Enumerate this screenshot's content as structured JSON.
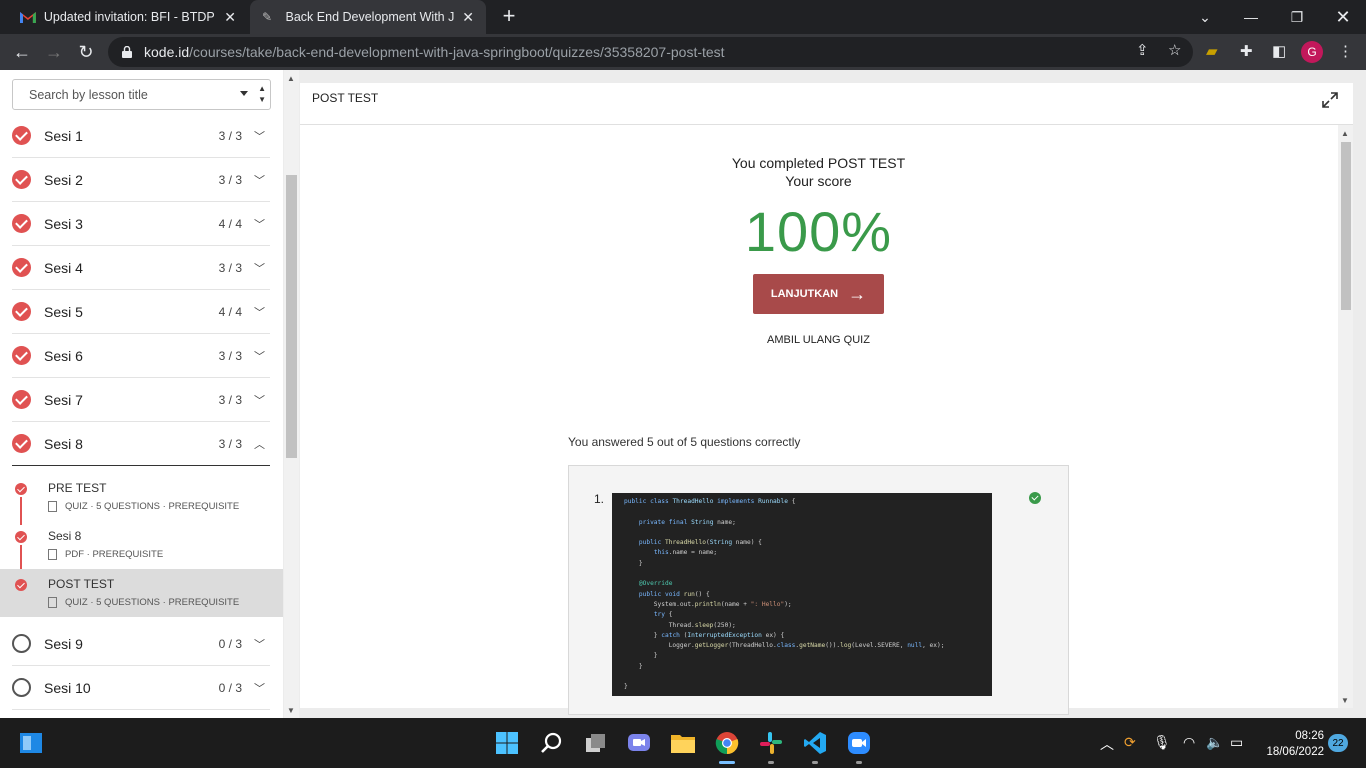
{
  "browser": {
    "tabs": [
      {
        "title": "Updated invitation: BFI - BTDP Bo",
        "icon": "gmail-icon"
      },
      {
        "title": "Back End Development With Java",
        "icon": "pen-icon"
      }
    ],
    "url_host": "kode.id",
    "url_path": "/courses/take/back-end-development-with-java-springboot/quizzes/35358207-post-test",
    "profile_initial": "G"
  },
  "sidebar": {
    "search_placeholder": "Search by lesson title",
    "sessions": [
      {
        "name": "Sesi 1",
        "count": "3 / 3",
        "done": true
      },
      {
        "name": "Sesi 2",
        "count": "3 / 3",
        "done": true
      },
      {
        "name": "Sesi 3",
        "count": "4 / 4",
        "done": true
      },
      {
        "name": "Sesi 4",
        "count": "3 / 3",
        "done": true
      },
      {
        "name": "Sesi 5",
        "count": "4 / 4",
        "done": true
      },
      {
        "name": "Sesi 6",
        "count": "3 / 3",
        "done": true
      },
      {
        "name": "Sesi 7",
        "count": "3 / 3",
        "done": true
      },
      {
        "name": "Sesi 8",
        "count": "3 / 3",
        "done": true
      },
      {
        "name": "Sesi 9",
        "count": "0 / 3",
        "done": false
      },
      {
        "name": "Sesi 10",
        "count": "0 / 3",
        "done": false
      }
    ],
    "lessons": [
      {
        "title": "PRE TEST",
        "meta": "QUIZ · 5 QUESTIONS · PREREQUISITE"
      },
      {
        "title": "Sesi 8",
        "meta": "PDF · PREREQUISITE"
      },
      {
        "title": "POST TEST",
        "meta": "QUIZ · 5 QUESTIONS · PREREQUISITE"
      }
    ]
  },
  "content": {
    "header_title": "POST TEST",
    "completed_text": "You completed POST TEST",
    "score_label": "Your score",
    "score": "100%",
    "continue_label": "LANJUTKAN",
    "retake_label": "AMBIL ULANG QUIZ",
    "answered_text": "You answered 5 out of 5 questions correctly",
    "question_number": "1."
  },
  "taskbar": {
    "time": "08:26",
    "date": "18/06/2022",
    "notifications": "22"
  },
  "colors": {
    "accent": "#a84a4a",
    "check": "#e05252",
    "score": "#3a9a4a"
  }
}
